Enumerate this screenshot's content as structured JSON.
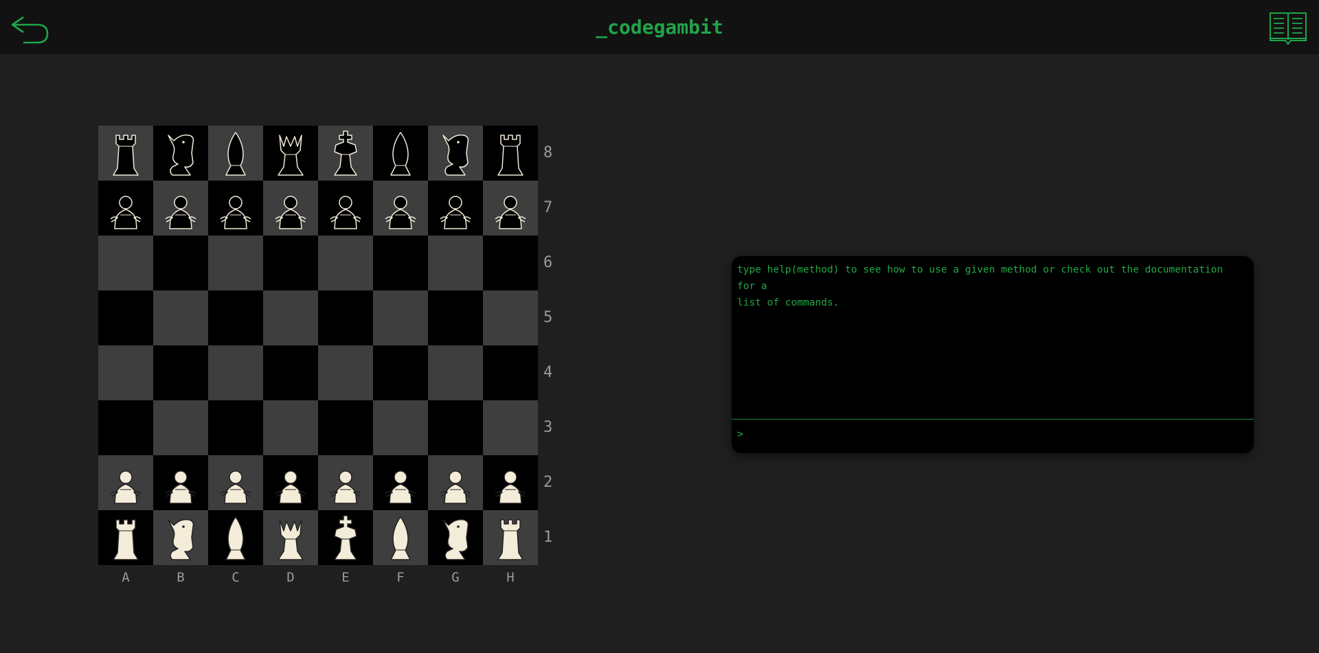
{
  "header": {
    "title": "_codegambit",
    "back_icon": "return-arrow-icon",
    "docs_icon": "open-book-icon",
    "accent_color": "#1fa54a"
  },
  "board": {
    "light_square_color": "#3e3e3e",
    "dark_square_color": "#000000",
    "white_piece_color": "#f3ecd9",
    "black_piece_color": "#000000",
    "ranks": [
      "8",
      "7",
      "6",
      "5",
      "4",
      "3",
      "2",
      "1"
    ],
    "files": [
      "A",
      "B",
      "C",
      "D",
      "E",
      "F",
      "G",
      "H"
    ],
    "position": [
      [
        "br",
        "bn",
        "bb",
        "bq",
        "bk",
        "bb",
        "bn",
        "br"
      ],
      [
        "bp",
        "bp",
        "bp",
        "bp",
        "bp",
        "bp",
        "bp",
        "bp"
      ],
      [
        "",
        "",
        "",
        "",
        "",
        "",
        "",
        ""
      ],
      [
        "",
        "",
        "",
        "",
        "",
        "",
        "",
        ""
      ],
      [
        "",
        "",
        "",
        "",
        "",
        "",
        "",
        ""
      ],
      [
        "",
        "",
        "",
        "",
        "",
        "",
        "",
        ""
      ],
      [
        "wp",
        "wp",
        "wp",
        "wp",
        "wp",
        "wp",
        "wp",
        "wp"
      ],
      [
        "wr",
        "wn",
        "wb",
        "wq",
        "wk",
        "wb",
        "wn",
        "wr"
      ]
    ]
  },
  "console": {
    "output_lines": [
      "type help(method) to see how to use a given method or check out the documentation for a",
      "list of commands."
    ],
    "prompt": ">",
    "input_value": "",
    "text_color": "#22a844"
  }
}
